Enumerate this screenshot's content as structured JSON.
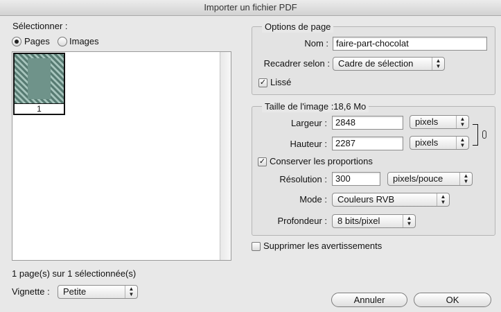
{
  "window": {
    "title": "Importer un fichier PDF"
  },
  "select_panel": {
    "legend": "Sélectionner :",
    "radio_pages": "Pages",
    "radio_images": "Images",
    "selected_mode": "Pages",
    "thumbnail_page_number": "1",
    "selection_status": "1 page(s) sur 1 sélectionnée(s)",
    "thumbnail_size_label": "Vignette :",
    "thumbnail_size_value": "Petite"
  },
  "page_options": {
    "legend": "Options de page",
    "name_label": "Nom :",
    "name_value": "faire-part-chocolat",
    "crop_label": "Recadrer selon :",
    "crop_value": "Cadre de sélection",
    "smooth_label": "Lissé",
    "smooth_checked": true
  },
  "image_size": {
    "legend": "Taille de l'image :18,6 Mo",
    "width_label": "Largeur :",
    "width_value": "2848",
    "width_unit": "pixels",
    "height_label": "Hauteur :",
    "height_value": "2287",
    "height_unit": "pixels",
    "constrain_label": "Conserver les proportions",
    "constrain_checked": true,
    "resolution_label": "Résolution :",
    "resolution_value": "300",
    "resolution_unit": "pixels/pouce",
    "mode_label": "Mode :",
    "mode_value": "Couleurs RVB",
    "depth_label": "Profondeur :",
    "depth_value": "8 bits/pixel"
  },
  "suppress_warnings": {
    "label": "Supprimer les avertissements",
    "checked": false
  },
  "buttons": {
    "cancel": "Annuler",
    "ok": "OK"
  },
  "glyphs": {
    "check": "✓",
    "popup_arrows_up": "▲",
    "popup_arrows_down": "▼"
  },
  "colors": {
    "window_bg": "#e8e8e8",
    "list_bg": "#ffffff",
    "thumbnail_green": "#6f938a"
  }
}
